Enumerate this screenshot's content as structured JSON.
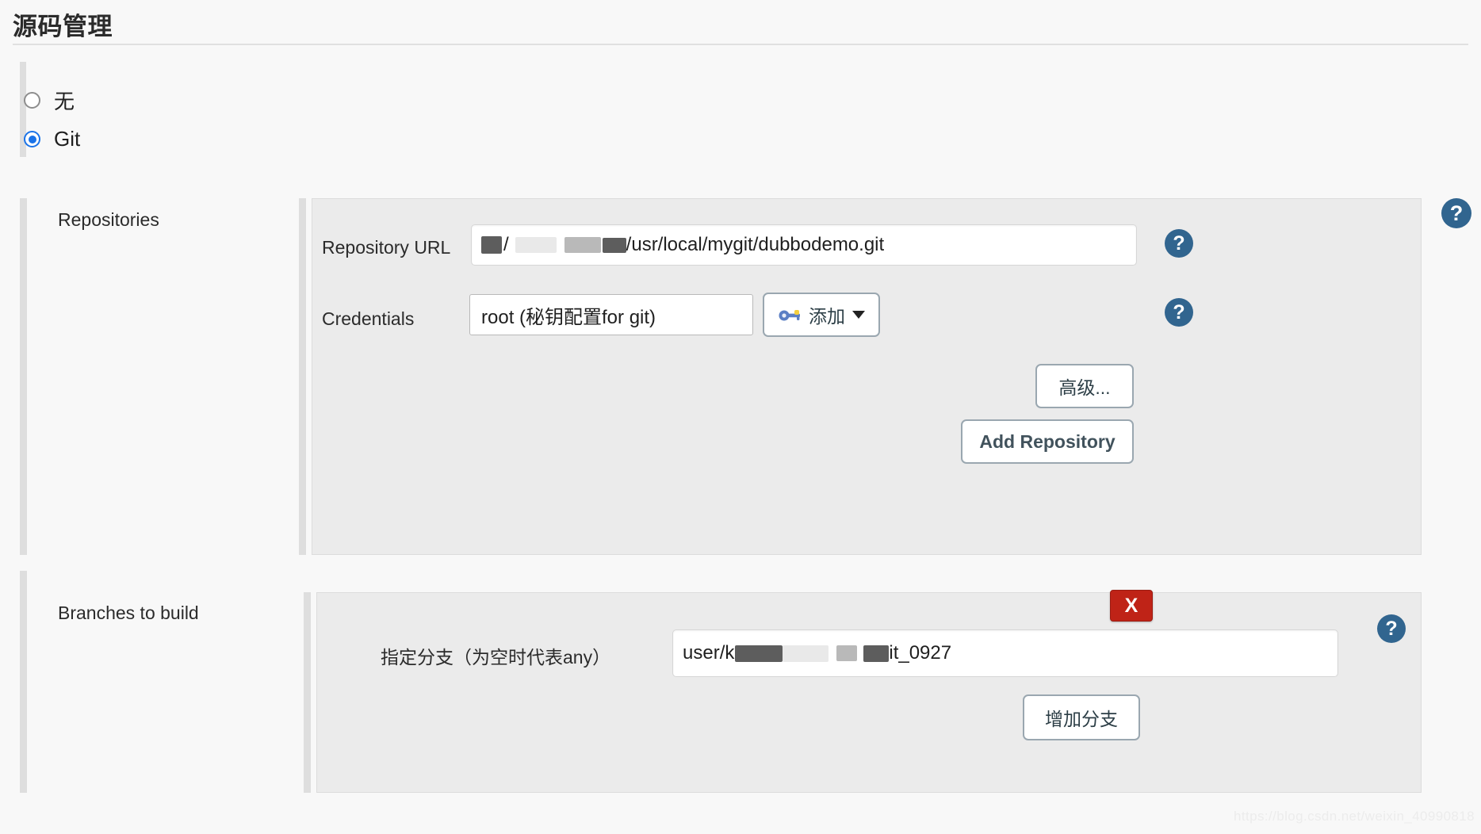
{
  "page": {
    "title": "源码管理",
    "watermark": "https://blog.csdn.net/weixin_40990818"
  },
  "scm_options": [
    {
      "label": "无",
      "selected": false
    },
    {
      "label": "Git",
      "selected": true
    }
  ],
  "repositories": {
    "section_label": "Repositories",
    "repository_url": {
      "label": "Repository URL",
      "value_visible_suffix": "/usr/local/mygit/dubbodemo.git",
      "value_redacted_prefix": "4/  .  ",
      "full_value": "4/ ████ .██/usr/local/mygit/dubbodemo.git"
    },
    "credentials": {
      "label": "Credentials",
      "selected_option": "root (秘钥配置for git)",
      "options": [
        "root (秘钥配置for git)"
      ]
    },
    "add_credentials_button": {
      "label": "添加",
      "icon": "key-icon",
      "has_dropdown": true
    },
    "advanced_button": "高级...",
    "add_repository_button": "Add Repository",
    "help_icon_label": "?"
  },
  "branches": {
    "section_label": "Branches to build",
    "branch_specifier": {
      "label": "指定分支（为空时代表any）",
      "value_visible_prefix": "user/k",
      "value_visible_suffix": "it_0927",
      "full_value": "user/k████ ██it_0927"
    },
    "delete_button": "X",
    "add_branch_button": "增加分支",
    "help_icon_label": "?"
  },
  "colors": {
    "accent_radio": "#1a73e8",
    "help_icon": "#31658f",
    "delete_button": "#bf2317",
    "panel_bg": "#ebebeb",
    "page_bg": "#f8f8f8",
    "rail": "#dedede"
  }
}
